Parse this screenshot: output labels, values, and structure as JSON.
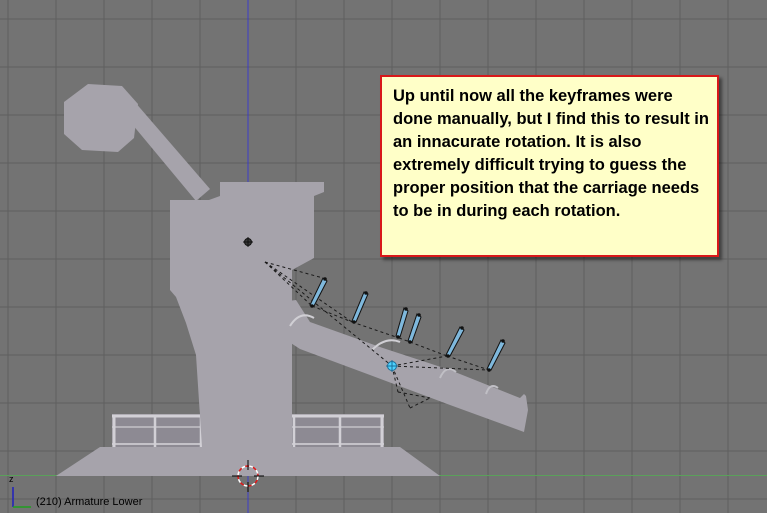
{
  "viewport": {
    "background": "#737373",
    "grid_color": "#5f5f5f",
    "model_color": "#a6a3ab"
  },
  "annotation": {
    "text": "Up until now all the keyframes were done manually, but I find this to result in an innacurate rotation. It is also extremely difficult trying to guess the proper position that the carriage needs to be in during each rotation.",
    "background": "#ffffc8",
    "border_color": "#d8181a"
  },
  "status": {
    "frame_label": "(210) Armature Lower"
  },
  "axes": {
    "z_label": "z"
  },
  "icons": [
    "3d-cursor-icon",
    "object-origin-icon",
    "axis-widget-icon"
  ]
}
